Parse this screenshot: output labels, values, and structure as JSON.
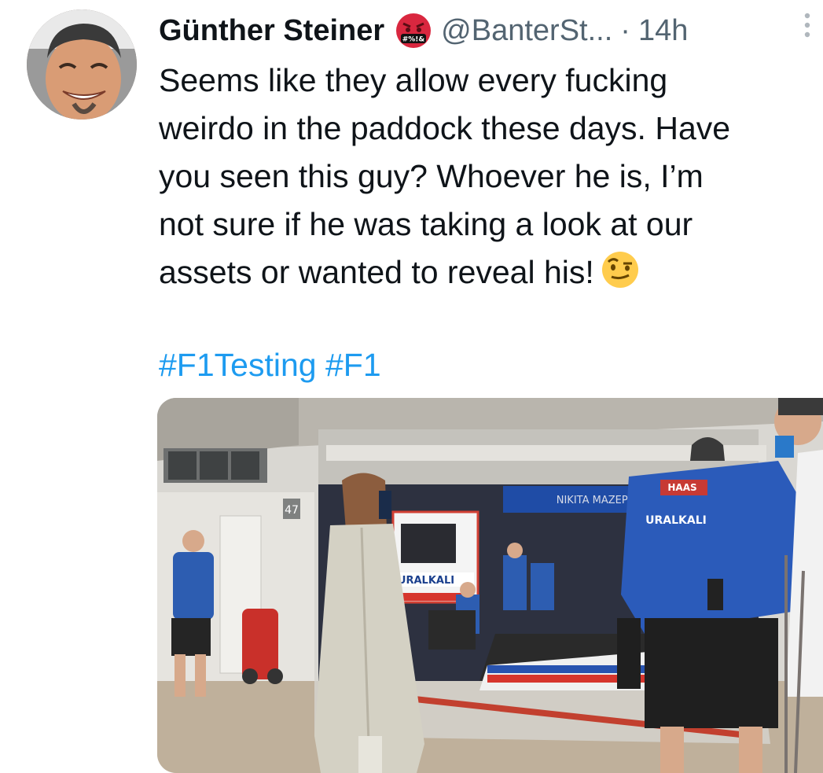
{
  "tweet": {
    "author": {
      "display_name": "Günther Steiner",
      "badge_icon": "angry-face-icon",
      "handle": "@BanterSt...",
      "separator": "·",
      "time": "14h"
    },
    "more_icon": "more-vertical-icon",
    "text_lines": [
      "Seems like they allow every fucking",
      "weirdo in the paddock these days. Have",
      "you seen this guy? Whoever he is, I’m",
      "not sure if he was taking a look at our",
      "assets or wanted to reveal his!"
    ],
    "trailing_emoji": "raised-eyebrow-face-icon",
    "hashtags": [
      "#F1Testing",
      "#F1"
    ],
    "media": {
      "description_icon": "paddock-photo",
      "garage_number": "47",
      "sponsor_text": "URALKALI",
      "sponsor_text_jacket": "URALKALI",
      "team_logo": "HAAS",
      "banner_text": "NIKITA MAZEPIN"
    }
  },
  "colors": {
    "text": "#0f1419",
    "secondary": "#536471",
    "link": "#1d9bf0",
    "background": "#ffffff"
  }
}
